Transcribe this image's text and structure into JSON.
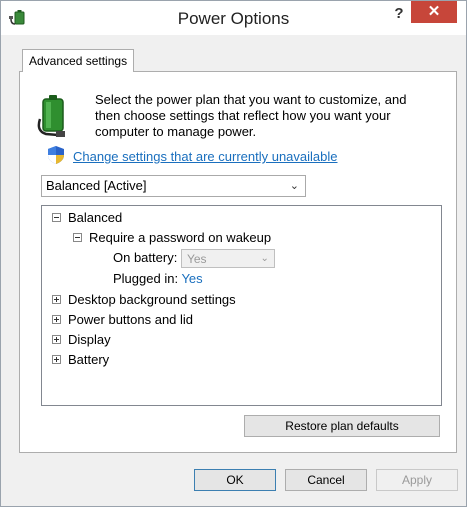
{
  "window": {
    "title": "Power Options",
    "help_label": "?",
    "close_label": "✕"
  },
  "tab": {
    "label": "Advanced settings"
  },
  "intro": {
    "text": "Select the power plan that you want to customize, and then choose settings that reflect how you want your computer to manage power."
  },
  "link": {
    "text": "Change settings that are currently unavailable"
  },
  "plan_select": {
    "value": "Balanced [Active]"
  },
  "tree": {
    "balanced": "Balanced",
    "require_password": "Require a password on wakeup",
    "on_battery_label": "On battery:",
    "on_battery_value": "Yes",
    "plugged_in_label": "Plugged in:",
    "plugged_in_value": "Yes",
    "desktop_background": "Desktop background settings",
    "power_buttons": "Power buttons and lid",
    "display": "Display",
    "battery": "Battery"
  },
  "buttons": {
    "restore": "Restore plan defaults",
    "ok": "OK",
    "cancel": "Cancel",
    "apply": "Apply"
  },
  "colors": {
    "close_button": "#c7463a",
    "link": "#1a6fbe"
  }
}
